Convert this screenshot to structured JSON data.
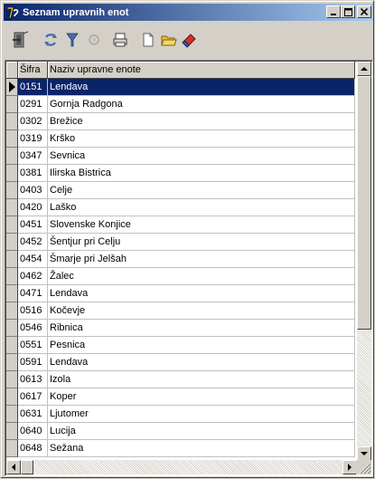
{
  "window": {
    "title": "Seznam upravnih enot",
    "minimize_label": "_",
    "maximize_label": "□",
    "close_label": "×",
    "title_gradient_start": "#0a246a",
    "title_gradient_end": "#a6caf0"
  },
  "toolbar": {
    "items": [
      {
        "name": "exit-door-icon",
        "interactable": true
      },
      {
        "name": "refresh-icon",
        "interactable": true
      },
      {
        "name": "filter-icon",
        "interactable": true
      },
      {
        "name": "search-disabled-icon",
        "interactable": false
      },
      {
        "name": "print-icon",
        "interactable": true
      },
      {
        "name": "new-document-icon",
        "interactable": true
      },
      {
        "name": "open-folder-icon",
        "interactable": true
      },
      {
        "name": "eraser-icon",
        "interactable": true
      }
    ]
  },
  "grid": {
    "columns": [
      "Šifra",
      "Naziv upravne enote"
    ],
    "selected_color": "#0a246a",
    "rows": [
      {
        "code": "0151",
        "name": "Lendava",
        "selected": true
      },
      {
        "code": "0291",
        "name": "Gornja Radgona"
      },
      {
        "code": "0302",
        "name": "Brežice"
      },
      {
        "code": "0319",
        "name": "Krško"
      },
      {
        "code": "0347",
        "name": "Sevnica"
      },
      {
        "code": "0381",
        "name": "Ilirska Bistrica"
      },
      {
        "code": "0403",
        "name": "Celje"
      },
      {
        "code": "0420",
        "name": "Laško"
      },
      {
        "code": "0451",
        "name": "Slovenske Konjice"
      },
      {
        "code": "0452",
        "name": "Šentjur pri Celju"
      },
      {
        "code": "0454",
        "name": "Šmarje pri Jelšah"
      },
      {
        "code": "0462",
        "name": "Žalec"
      },
      {
        "code": "0471",
        "name": "Lendava"
      },
      {
        "code": "0516",
        "name": "Kočevje"
      },
      {
        "code": "0546",
        "name": "Ribnica"
      },
      {
        "code": "0551",
        "name": "Pesnica"
      },
      {
        "code": "0591",
        "name": "Lendava"
      },
      {
        "code": "0613",
        "name": "Izola"
      },
      {
        "code": "0617",
        "name": "Koper"
      },
      {
        "code": "0631",
        "name": "Ljutomer"
      },
      {
        "code": "0640",
        "name": "Lucija"
      },
      {
        "code": "0648",
        "name": "Sežana"
      }
    ]
  }
}
